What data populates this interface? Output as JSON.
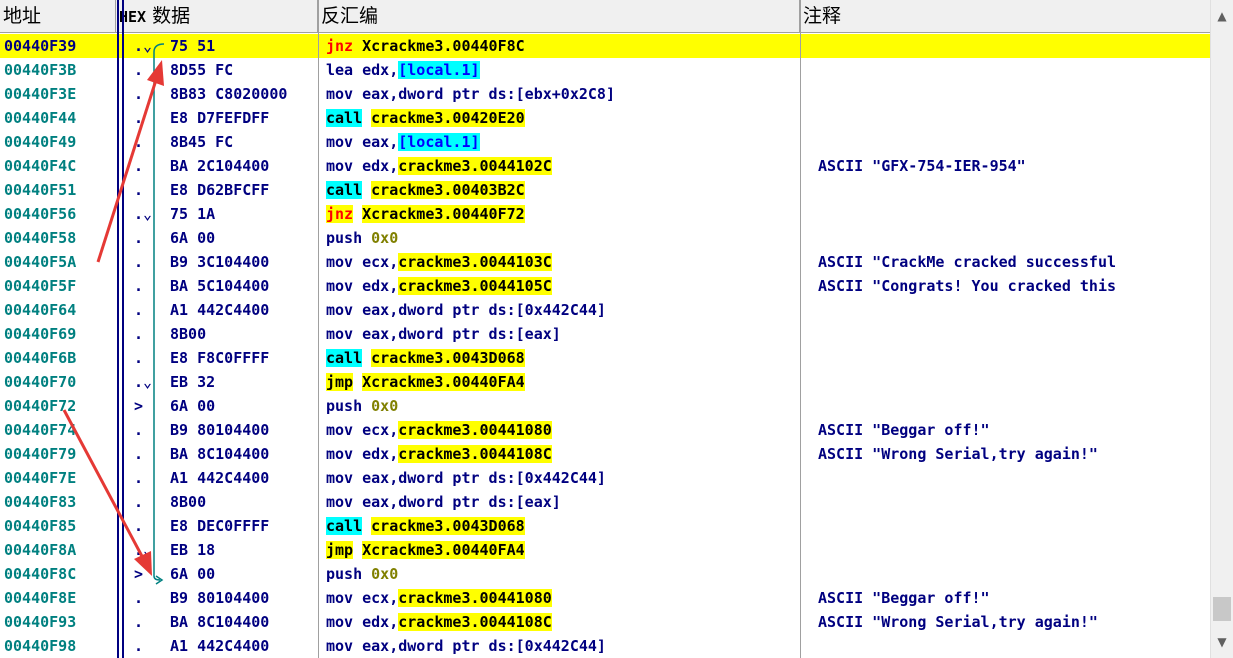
{
  "header": {
    "address": "地址",
    "hex_prefix": "HEX",
    "hex_rest": " 数据",
    "disassembly": "反汇编",
    "comment": "注释"
  },
  "scrollbar": {
    "up_icon": "chevron-up-icon",
    "down_icon": "chevron-down-icon"
  },
  "colors": {
    "selection": "#ffff00",
    "address": "#008080",
    "code": "#000080",
    "call_bg": "#00ffff",
    "jcc_text": "#ff0000",
    "jump_arrow": "#008080",
    "annotation_arrow": "#e53935"
  },
  "rows": [
    {
      "addr": "00440F39",
      "mark": ".⌄",
      "hex": "75 51",
      "sel": true,
      "dis": [
        [
          "op-jcc",
          "jnz"
        ],
        [
          "",
          " "
        ],
        [
          "t-y",
          "Xcrackme3.00440F8C"
        ]
      ],
      "com": ""
    },
    {
      "addr": "00440F3B",
      "mark": ".",
      "hex": "8D55 FC",
      "dis": [
        [
          "",
          "lea edx,"
        ],
        [
          "t-c",
          "[local.1]"
        ]
      ],
      "com": ""
    },
    {
      "addr": "00440F3E",
      "mark": ".",
      "hex": "8B83 C8020000",
      "dis": [
        [
          "",
          "mov eax,dword ptr ds:[ebx+0x2C8]"
        ]
      ],
      "com": ""
    },
    {
      "addr": "00440F44",
      "mark": ".",
      "hex": "E8 D7FEFDFF",
      "dis": [
        [
          "op-call",
          "call"
        ],
        [
          "",
          " "
        ],
        [
          "t-y",
          "crackme3.00420E20"
        ]
      ],
      "com": ""
    },
    {
      "addr": "00440F49",
      "mark": ".",
      "hex": "8B45 FC",
      "dis": [
        [
          "",
          "mov eax,"
        ],
        [
          "t-c",
          "[local.1]"
        ]
      ],
      "com": ""
    },
    {
      "addr": "00440F4C",
      "mark": ".",
      "hex": "BA 2C104400",
      "dis": [
        [
          "",
          "mov edx,"
        ],
        [
          "t-y",
          "crackme3.0044102C"
        ]
      ],
      "com": "ASCII \"GFX-754-IER-954\""
    },
    {
      "addr": "00440F51",
      "mark": ".",
      "hex": "E8 D62BFCFF",
      "dis": [
        [
          "op-call",
          "call"
        ],
        [
          "",
          " "
        ],
        [
          "t-y",
          "crackme3.00403B2C"
        ]
      ],
      "com": ""
    },
    {
      "addr": "00440F56",
      "mark": ".⌄",
      "hex": "75 1A",
      "dis": [
        [
          "op-jcc",
          "jnz"
        ],
        [
          "",
          " "
        ],
        [
          "t-y",
          "Xcrackme3.00440F72"
        ]
      ],
      "com": ""
    },
    {
      "addr": "00440F58",
      "mark": ".",
      "hex": "6A 00",
      "dis": [
        [
          "",
          "push "
        ],
        [
          "t-num",
          "0x0"
        ]
      ],
      "com": ""
    },
    {
      "addr": "00440F5A",
      "mark": ".",
      "hex": "B9 3C104400",
      "dis": [
        [
          "",
          "mov ecx,"
        ],
        [
          "t-y",
          "crackme3.0044103C"
        ]
      ],
      "com": "ASCII \"CrackMe cracked successful"
    },
    {
      "addr": "00440F5F",
      "mark": ".",
      "hex": "BA 5C104400",
      "dis": [
        [
          "",
          "mov edx,"
        ],
        [
          "t-y",
          "crackme3.0044105C"
        ]
      ],
      "com": "ASCII \"Congrats! You cracked this"
    },
    {
      "addr": "00440F64",
      "mark": ".",
      "hex": "A1 442C4400",
      "dis": [
        [
          "",
          "mov eax,dword ptr ds:[0x442C44]"
        ]
      ],
      "com": ""
    },
    {
      "addr": "00440F69",
      "mark": ".",
      "hex": "8B00",
      "dis": [
        [
          "",
          "mov eax,dword ptr ds:[eax]"
        ]
      ],
      "com": ""
    },
    {
      "addr": "00440F6B",
      "mark": ".",
      "hex": "E8 F8C0FFFF",
      "dis": [
        [
          "op-call",
          "call"
        ],
        [
          "",
          " "
        ],
        [
          "t-y",
          "crackme3.0043D068"
        ]
      ],
      "com": ""
    },
    {
      "addr": "00440F70",
      "mark": ".⌄",
      "hex": "EB 32",
      "dis": [
        [
          "op-jmp",
          "jmp"
        ],
        [
          "",
          " "
        ],
        [
          "t-y",
          "Xcrackme3.00440FA4"
        ]
      ],
      "com": ""
    },
    {
      "addr": "00440F72",
      "mark": ">",
      "hex": "6A 00",
      "dis": [
        [
          "",
          "push "
        ],
        [
          "t-num",
          "0x0"
        ]
      ],
      "com": ""
    },
    {
      "addr": "00440F74",
      "mark": ".",
      "hex": "B9 80104400",
      "dis": [
        [
          "",
          "mov ecx,"
        ],
        [
          "t-y",
          "crackme3.00441080"
        ]
      ],
      "com": "ASCII \"Beggar off!\""
    },
    {
      "addr": "00440F79",
      "mark": ".",
      "hex": "BA 8C104400",
      "dis": [
        [
          "",
          "mov edx,"
        ],
        [
          "t-y",
          "crackme3.0044108C"
        ]
      ],
      "com": "ASCII \"Wrong Serial,try again!\""
    },
    {
      "addr": "00440F7E",
      "mark": ".",
      "hex": "A1 442C4400",
      "dis": [
        [
          "",
          "mov eax,dword ptr ds:[0x442C44]"
        ]
      ],
      "com": ""
    },
    {
      "addr": "00440F83",
      "mark": ".",
      "hex": "8B00",
      "dis": [
        [
          "",
          "mov eax,dword ptr ds:[eax]"
        ]
      ],
      "com": ""
    },
    {
      "addr": "00440F85",
      "mark": ".",
      "hex": "E8 DEC0FFFF",
      "dis": [
        [
          "op-call",
          "call"
        ],
        [
          "",
          " "
        ],
        [
          "t-y",
          "crackme3.0043D068"
        ]
      ],
      "com": ""
    },
    {
      "addr": "00440F8A",
      "mark": ".⌄",
      "hex": "EB 18",
      "dis": [
        [
          "op-jmp",
          "jmp"
        ],
        [
          "",
          " "
        ],
        [
          "t-y",
          "Xcrackme3.00440FA4"
        ]
      ],
      "com": ""
    },
    {
      "addr": "00440F8C",
      "mark": ">",
      "hex": "6A 00",
      "dis": [
        [
          "",
          "push "
        ],
        [
          "t-num",
          "0x0"
        ]
      ],
      "com": ""
    },
    {
      "addr": "00440F8E",
      "mark": ".",
      "hex": "B9 80104400",
      "dis": [
        [
          "",
          "mov ecx,"
        ],
        [
          "t-y",
          "crackme3.00441080"
        ]
      ],
      "com": "ASCII \"Beggar off!\""
    },
    {
      "addr": "00440F93",
      "mark": ".",
      "hex": "BA 8C104400",
      "dis": [
        [
          "",
          "mov edx,"
        ],
        [
          "t-y",
          "crackme3.0044108C"
        ]
      ],
      "com": "ASCII \"Wrong Serial,try again!\""
    },
    {
      "addr": "00440F98",
      "mark": ".",
      "hex": "A1 442C4400",
      "dis": [
        [
          "",
          "mov eax,dword ptr ds:[0x442C44]"
        ]
      ],
      "com": ""
    }
  ]
}
